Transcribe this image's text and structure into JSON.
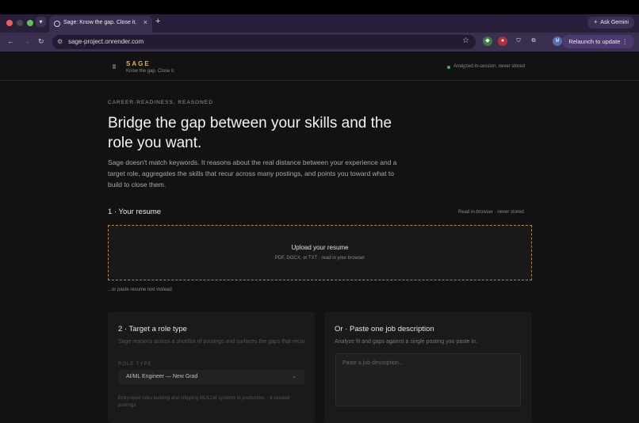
{
  "browser": {
    "tab_title": "Sage: Know the gap. Close it.",
    "new_tab": "+",
    "tab_close": "×",
    "ask_gemini": "Ask Gemini",
    "url": "sage-project.onrender.com",
    "relaunch": "Relaunch to update",
    "avatar_initial": "M",
    "more": "⋮"
  },
  "site": {
    "brand": "SAGE",
    "tagline": "Know the gap. Close it.",
    "status": "Analyzed in-session, never stored"
  },
  "hero": {
    "eyebrow": "CAREER-READINESS, REASONED",
    "headline": "Bridge the gap between your skills and the role you want.",
    "lede": "Sage doesn't match keywords. It reasons about the real distance between your experience and a target role, aggregates the skills that recur across many postings, and points you toward what to build to close them."
  },
  "resume": {
    "title": "1 · Your resume",
    "note": "Read in-browser · never stored",
    "upload_title": "Upload your resume",
    "upload_sub": "PDF, DOCX, or TXT · read in your browser",
    "paste_link": "...or paste resume text instead"
  },
  "role": {
    "title": "2 · Target a role type",
    "desc": "Sage reasons across a shortlist of postings and surfaces the gaps that recur.",
    "field_label": "ROLE TYPE",
    "selected": "AI/ML Engineer — New Grad",
    "foot": "Entry-level roles building and shipping ML/LLM systems to production. · 8 seeded postings"
  },
  "jd": {
    "title": "Or · Paste one job description",
    "desc": "Analyze fit and gaps against a single posting you paste in.",
    "placeholder": "Paste a job description..."
  }
}
